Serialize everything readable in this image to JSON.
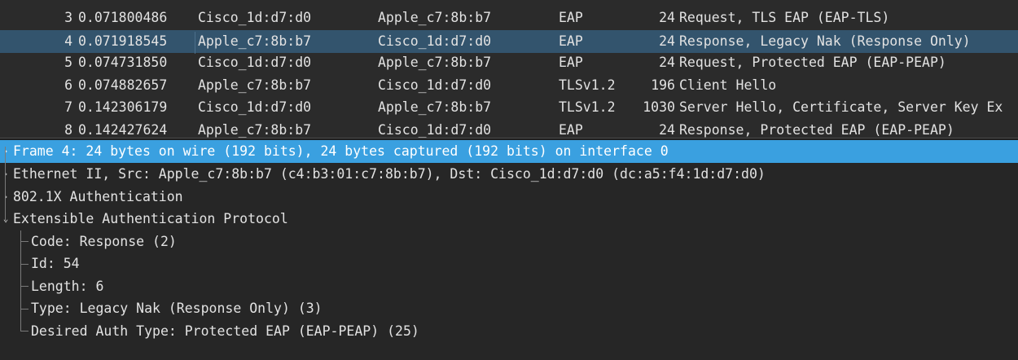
{
  "packet_list": {
    "rows": [
      {
        "no": "3",
        "time": "0.071800486",
        "source": "Cisco_1d:d7:d0",
        "destination": "Apple_c7:8b:b7",
        "protocol": "EAP",
        "length": "24",
        "info": "Request, TLS EAP (EAP-TLS)",
        "selected": false
      },
      {
        "no": "4",
        "time": "0.071918545",
        "source": "Apple_c7:8b:b7",
        "destination": "Cisco_1d:d7:d0",
        "protocol": "EAP",
        "length": "24",
        "info": "Response, Legacy Nak (Response Only)",
        "selected": true
      },
      {
        "no": "5",
        "time": "0.074731850",
        "source": "Cisco_1d:d7:d0",
        "destination": "Apple_c7:8b:b7",
        "protocol": "EAP",
        "length": "24",
        "info": "Request, Protected EAP (EAP-PEAP)",
        "selected": false
      },
      {
        "no": "6",
        "time": "0.074882657",
        "source": "Apple_c7:8b:b7",
        "destination": "Cisco_1d:d7:d0",
        "protocol": "TLSv1.2",
        "length": "196",
        "info": "Client Hello",
        "selected": false
      },
      {
        "no": "7",
        "time": "0.142306179",
        "source": "Cisco_1d:d7:d0",
        "destination": "Apple_c7:8b:b7",
        "protocol": "TLSv1.2",
        "length": "1030",
        "info": "Server Hello, Certificate, Server Key Ex",
        "selected": false
      },
      {
        "no": "8",
        "time": "0.142427624",
        "source": "Apple_c7:8b:b7",
        "destination": "Cisco_1d:d7:d0",
        "protocol": "EAP",
        "length": "24",
        "info": "Response, Protected EAP (EAP-PEAP)",
        "selected": false
      }
    ]
  },
  "details": {
    "frame": "Frame 4: 24 bytes on wire (192 bits), 24 bytes captured (192 bits) on interface 0",
    "ethernet": "Ethernet II, Src: Apple_c7:8b:b7 (c4:b3:01:c7:8b:b7), Dst: Cisco_1d:d7:d0 (dc:a5:f4:1d:d7:d0)",
    "dot1x": "802.1X Authentication",
    "eap": "Extensible Authentication Protocol",
    "eap_fields": [
      "Code: Response (2)",
      "Id: 54",
      "Length: 6",
      "Type: Legacy Nak (Response Only) (3)",
      "Desired Auth Type: Protected EAP (EAP-PEAP) (25)"
    ],
    "collapsed_arrow": "›",
    "expanded_arrow": "⌄"
  },
  "colors": {
    "background": "#2b2b2b",
    "selected_row": "#33546d",
    "frame_highlight": "#3aa0e0",
    "text": "#e2e2e2"
  }
}
